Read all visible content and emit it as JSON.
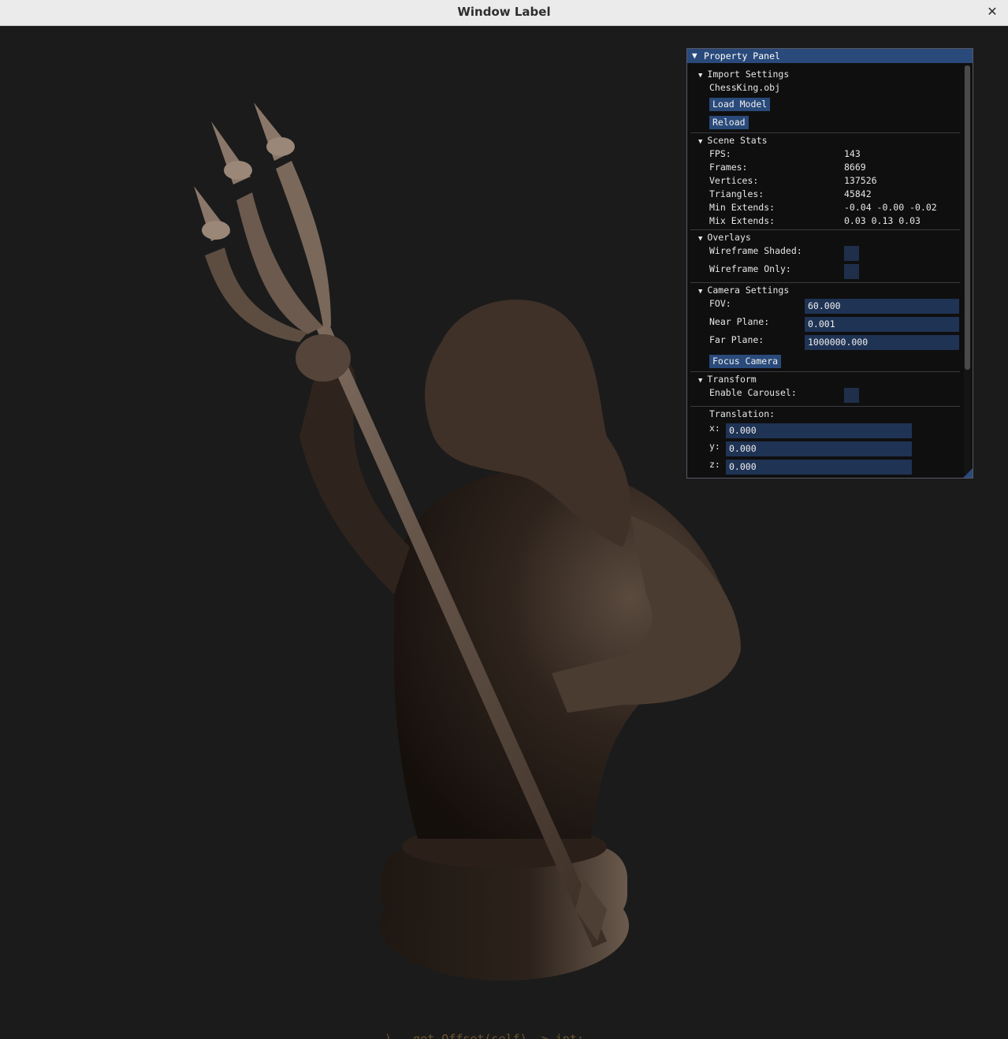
{
  "window": {
    "title": "Window Label",
    "close_glyph": "✕"
  },
  "panel": {
    "title": "Property Panel",
    "import_settings": {
      "title": "Import Settings",
      "file_name": "ChessKing.obj",
      "load_model_label": "Load Model",
      "reload_label": "Reload"
    },
    "scene_stats": {
      "title": "Scene Stats",
      "rows": [
        {
          "label": "FPS:",
          "value": "143"
        },
        {
          "label": "Frames:",
          "value": "8669"
        },
        {
          "label": "Vertices:",
          "value": "137526"
        },
        {
          "label": "Triangles:",
          "value": "45842"
        },
        {
          "label": "Min Extends:",
          "value": "-0.04 -0.00 -0.02"
        },
        {
          "label": "Mix Extends:",
          "value": "0.03 0.13 0.03"
        }
      ]
    },
    "overlays": {
      "title": "Overlays",
      "wireframe_shaded_label": "Wireframe Shaded:",
      "wireframe_only_label": "Wireframe Only:"
    },
    "camera_settings": {
      "title": "Camera Settings",
      "fov_label": "FOV:",
      "fov_value": "60.000",
      "near_label": "Near Plane:",
      "near_value": "0.001",
      "far_label": "Far Plane:",
      "far_value": "1000000.000",
      "focus_label": "Focus Camera"
    },
    "transform": {
      "title": "Transform",
      "carousel_label": "Enable Carousel:",
      "translation_label": "Translation:",
      "x_label": "x:",
      "x_value": "0.000",
      "y_label": "y:",
      "y_value": "0.000",
      "z_label": "z:",
      "z_value": "0.000"
    }
  },
  "background_text": "  )   get_Offset(self) -> int:",
  "colors": {
    "accent": "#294a7a",
    "input_bg": "#1f3354",
    "viewport_bg": "#1b1b1b",
    "model": "#3a2d24"
  }
}
